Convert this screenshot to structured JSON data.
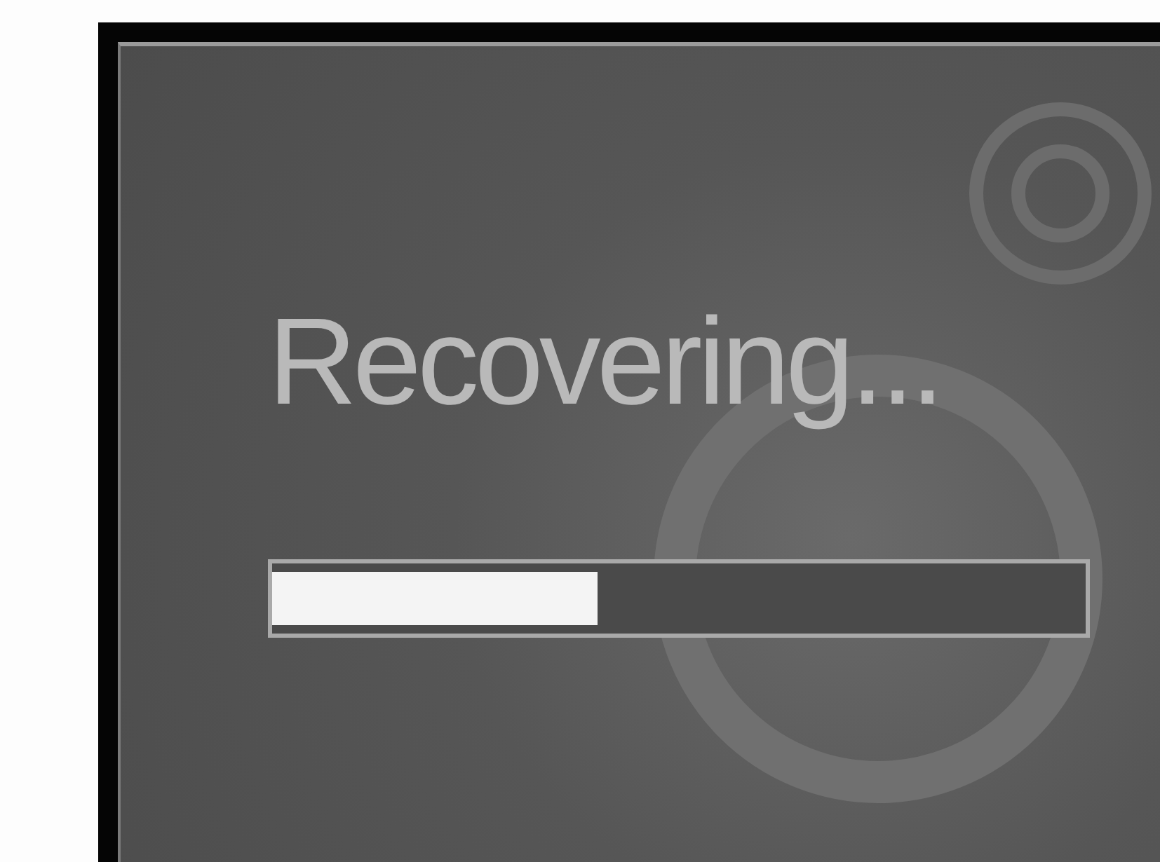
{
  "screen": {
    "message": "Recovering...",
    "progress": {
      "level": 0.4
    }
  }
}
